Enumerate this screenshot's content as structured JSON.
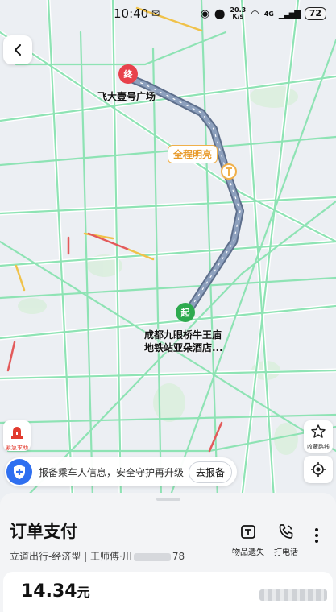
{
  "status_bar": {
    "time": "10:40",
    "net_speed_value": "20.3",
    "net_speed_unit": "K/s",
    "network": "4G",
    "battery": "72"
  },
  "map": {
    "start_marker": "起",
    "end_marker": "终",
    "end_label": "飞大壹号广场",
    "start_label_line1": "成都九眼桥牛王庙",
    "start_label_line2": "地铁站亚朵酒店...",
    "route_tag": "全程明亮",
    "route_color": "#7f8ea6",
    "end_color": "#e8414b",
    "start_color": "#2eaa4f"
  },
  "controls": {
    "sos_label": "紧急求助",
    "fav_route_label": "收藏路线"
  },
  "safety_banner": {
    "message": "报备乘车人信息，安全守护再升级",
    "button": "去报备"
  },
  "order": {
    "title": "订单支付",
    "subtitle_prefix": "立道出行-经济型 | 王师傅·川",
    "subtitle_suffix": "78",
    "lost_items_label": "物品遗失",
    "call_label": "打电话",
    "price": "14.34",
    "price_unit": "元"
  }
}
